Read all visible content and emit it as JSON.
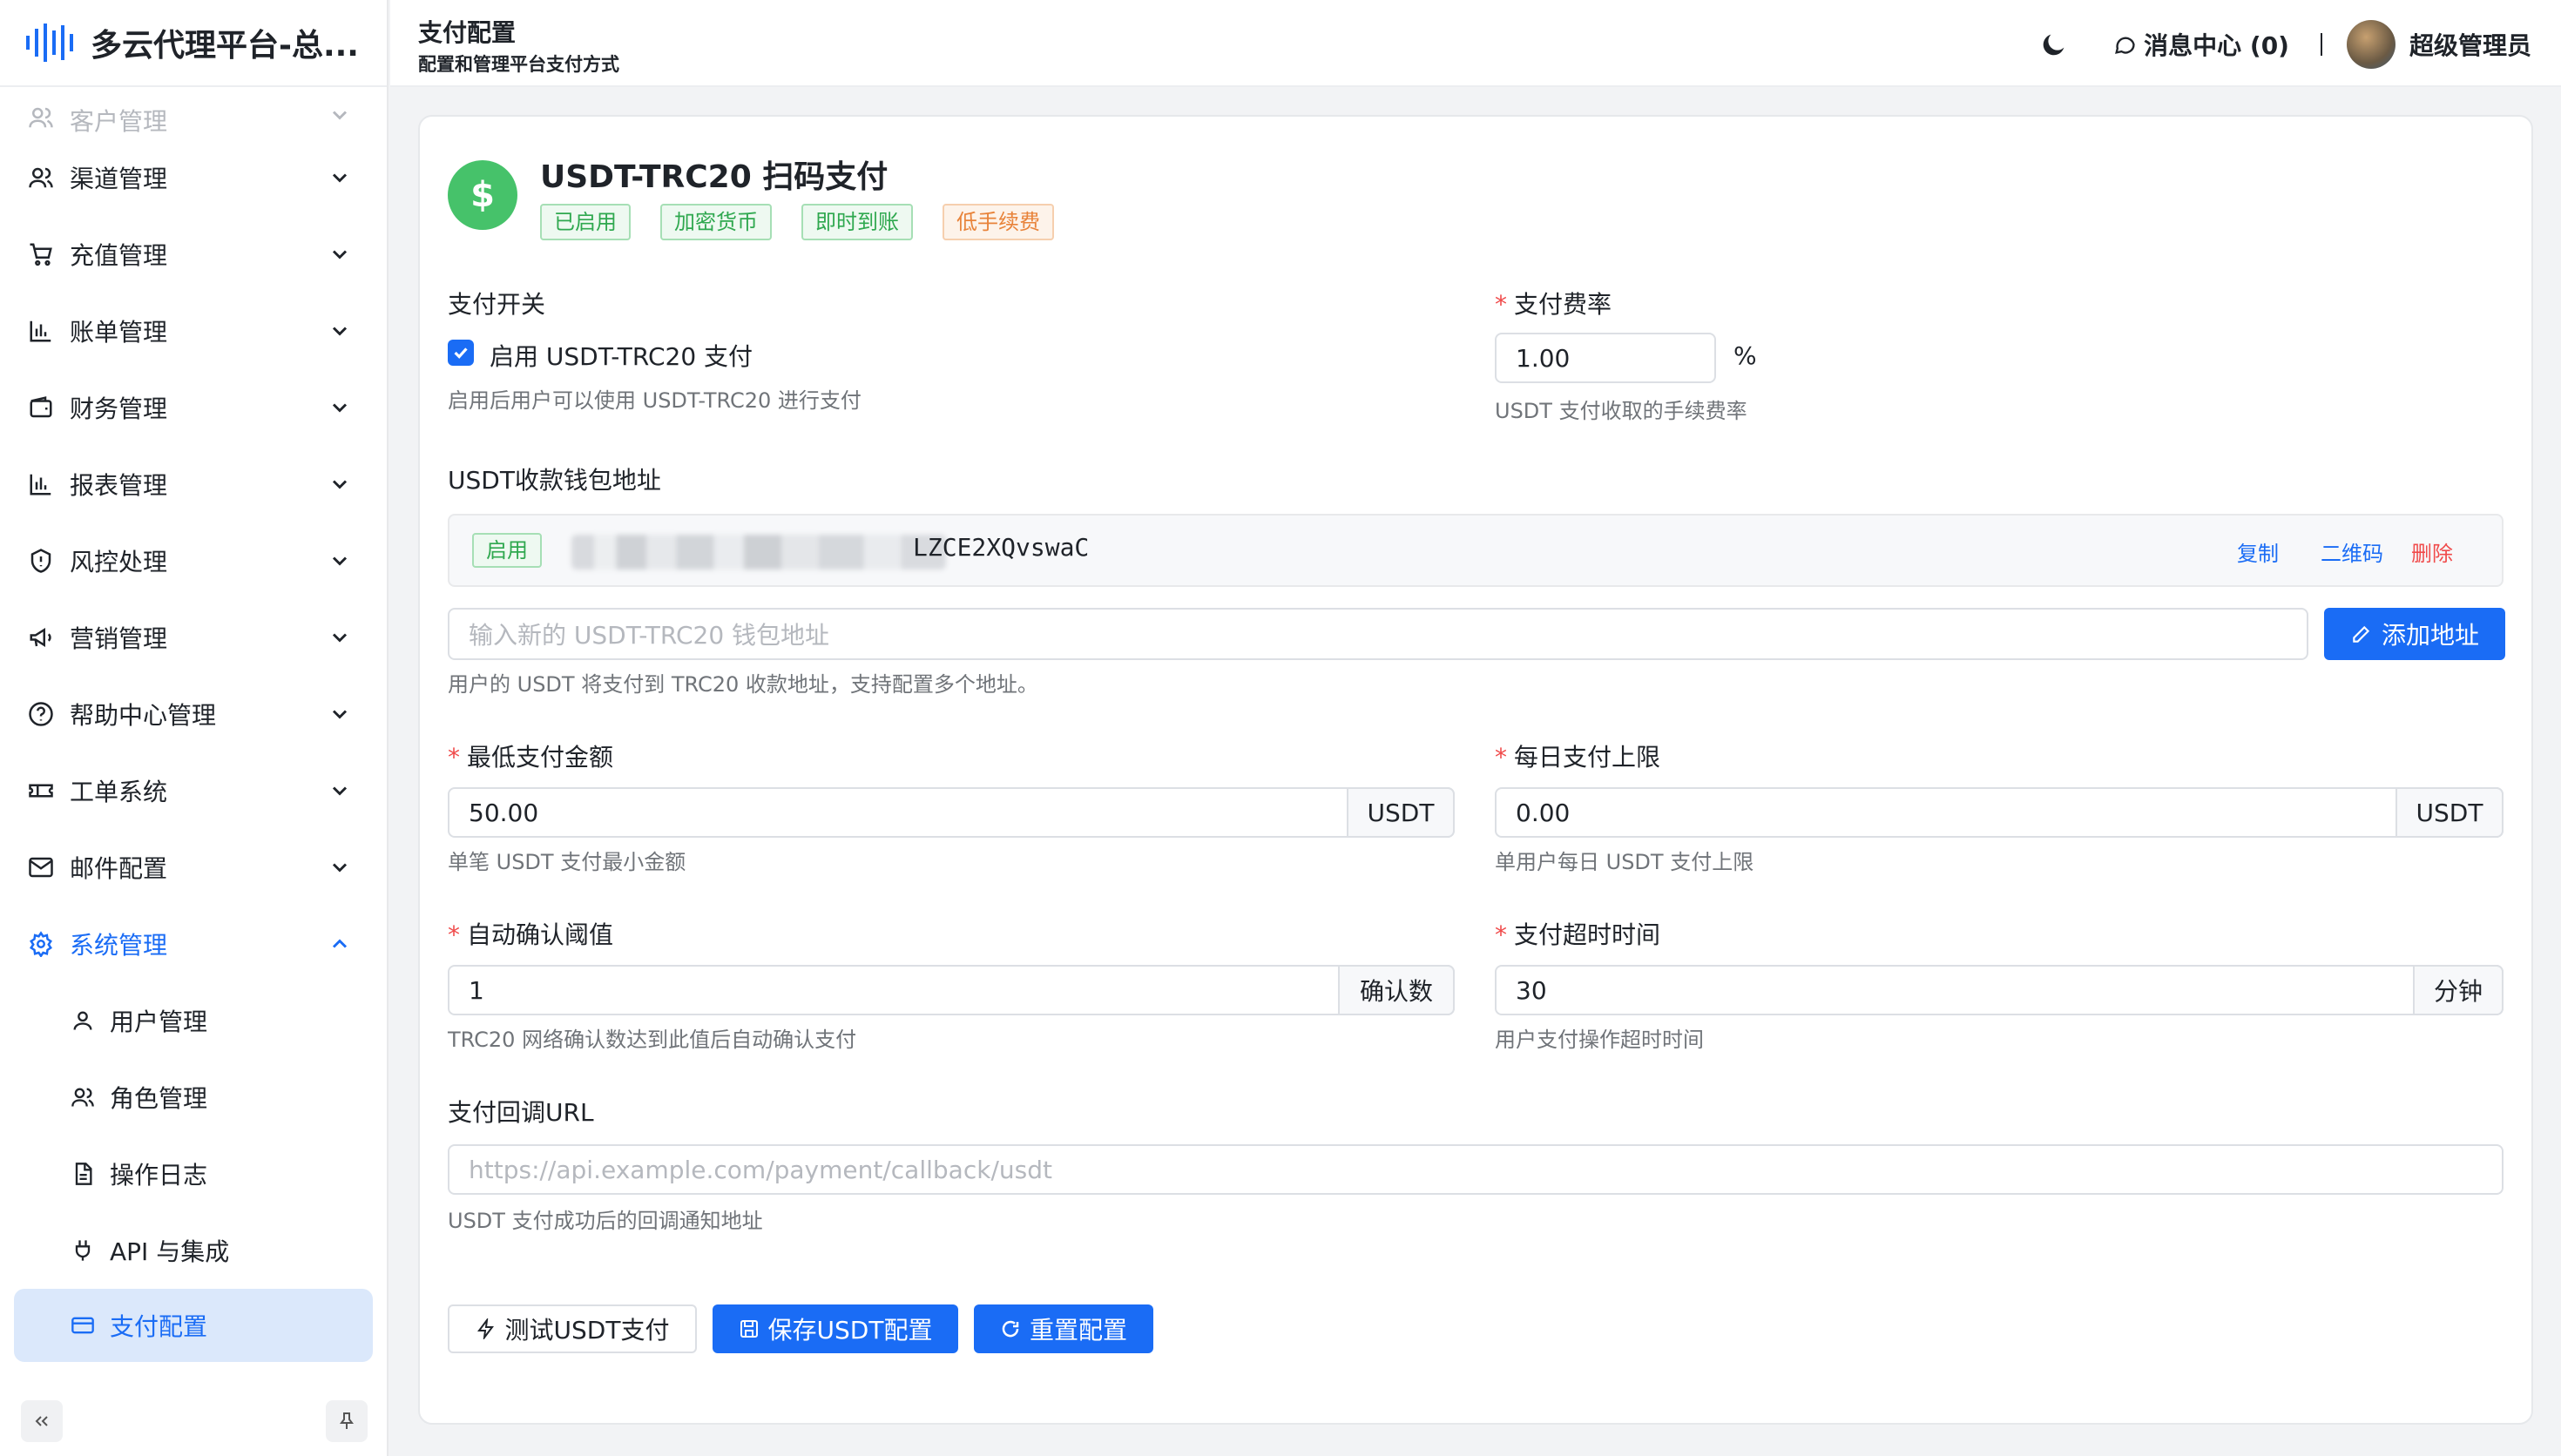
{
  "app": {
    "title": "多云代理平台-总..."
  },
  "sidebar": {
    "items": [
      {
        "label": "客户管理",
        "icon": "users-icon"
      },
      {
        "label": "渠道管理",
        "icon": "users-icon"
      },
      {
        "label": "充值管理",
        "icon": "cart-icon"
      },
      {
        "label": "账单管理",
        "icon": "bar-chart-icon"
      },
      {
        "label": "财务管理",
        "icon": "wallet-icon"
      },
      {
        "label": "报表管理",
        "icon": "bar-chart-icon"
      },
      {
        "label": "风控处理",
        "icon": "shield-icon"
      },
      {
        "label": "营销管理",
        "icon": "megaphone-icon"
      },
      {
        "label": "帮助中心管理",
        "icon": "help-icon"
      },
      {
        "label": "工单系统",
        "icon": "ticket-icon"
      },
      {
        "label": "邮件配置",
        "icon": "mail-icon"
      },
      {
        "label": "系统管理",
        "icon": "gear-icon"
      }
    ],
    "sub_items": [
      {
        "label": "用户管理",
        "icon": "user-icon"
      },
      {
        "label": "角色管理",
        "icon": "users-icon"
      },
      {
        "label": "操作日志",
        "icon": "document-icon"
      },
      {
        "label": "API 与集成",
        "icon": "plug-icon"
      },
      {
        "label": "支付配置",
        "icon": "card-icon"
      }
    ]
  },
  "header": {
    "title": "支付配置",
    "subtitle": "配置和管理平台支付方式",
    "messages": "消息中心 (0)",
    "user": "超级管理员"
  },
  "payment": {
    "title": "USDT-TRC20 扫码支付",
    "tags": [
      "已启用",
      "加密货币",
      "即时到账",
      "低手续费"
    ],
    "switch_label": "支付开关",
    "enable_label": "启用 USDT-TRC20 支付",
    "enable_hint": "启用后用户可以使用 USDT-TRC20 进行支付",
    "fee_label": "支付费率",
    "fee_value": "1.00",
    "fee_unit": "%",
    "fee_hint": "USDT 支付收取的手续费率",
    "wallet_label": "USDT收款钱包地址",
    "wallet": {
      "status": "启用",
      "address_visible": "LZCE2XQvswaC",
      "copy": "复制",
      "qrcode": "二维码",
      "delete": "删除"
    },
    "new_address_placeholder": "输入新的 USDT-TRC20 钱包地址",
    "add_address": "添加地址",
    "wallet_hint": "用户的 USDT 将支付到 TRC20 收款地址，支持配置多个地址。",
    "min_label": "最低支付金额",
    "min_value": "50.00",
    "min_unit": "USDT",
    "min_hint": "单笔 USDT 支付最小金额",
    "daily_label": "每日支付上限",
    "daily_value": "0.00",
    "daily_unit": "USDT",
    "daily_hint": "单用户每日 USDT 支付上限",
    "confirm_label": "自动确认阈值",
    "confirm_value": "1",
    "confirm_unit": "确认数",
    "confirm_hint": "TRC20 网络确认数达到此值后自动确认支付",
    "timeout_label": "支付超时时间",
    "timeout_value": "30",
    "timeout_unit": "分钟",
    "timeout_hint": "用户支付操作超时时间",
    "callback_label": "支付回调URL",
    "callback_placeholder": "https://api.example.com/payment/callback/usdt",
    "callback_hint": "USDT 支付成功后的回调通知地址",
    "test_button": "测试USDT支付",
    "save_button": "保存USDT配置",
    "reset_button": "重置配置"
  },
  "colors": {
    "primary": "#1a6cf5",
    "success": "#2fa84f",
    "danger": "#f04b4b",
    "warning": "#e8833a",
    "icon_green": "#46c26a"
  }
}
